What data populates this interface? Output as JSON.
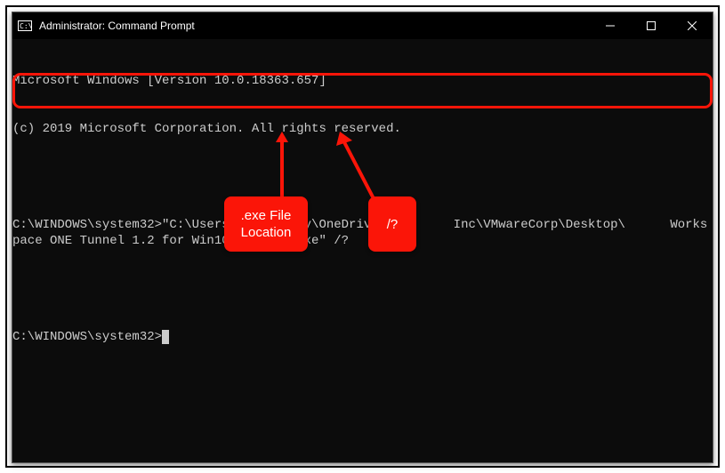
{
  "window": {
    "title": "Administrator: Command Prompt"
  },
  "terminal": {
    "line1": "Microsoft Windows [Version 10.0.18363.657]",
    "line2": "(c) 2019 Microsoft Corporation. All rights reserved.",
    "cmd_line": "C:\\WINDOWS\\system32>\"C:\\Users\\dweatherly\\OneDrive -        Inc\\VMwareCorp\\Desktop\\      Workspace ONE Tunnel 1.2 for Win10_Desktop.exe\" /?",
    "prompt2": "C:\\WINDOWS\\system32>"
  },
  "annotations": {
    "callout1": ".exe File Location",
    "callout2": "/?"
  }
}
